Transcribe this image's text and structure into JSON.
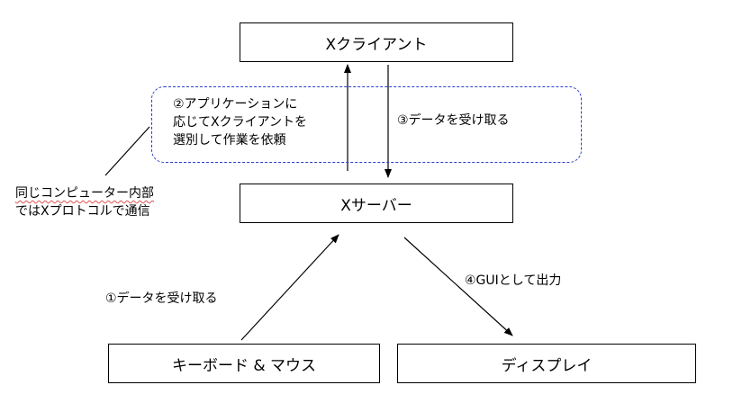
{
  "nodes": {
    "x_client": "Xクライアント",
    "x_server": "Xサーバー",
    "keyboard_mouse": "キーボード & マウス",
    "display": "ディスプレイ"
  },
  "edges": {
    "app_request": [
      "②アプリケーションに",
      "応じてXクライアントを",
      "選別して作業を依頼"
    ],
    "client_receive": "③データを受け取る",
    "server_receive": "①データを受け取る",
    "gui_output": "④GUIとして出力"
  },
  "note": {
    "lines": [
      "同じコンピューター内部",
      "ではXプロトコルで通信"
    ]
  },
  "colors": {
    "line": "#000000",
    "group_border": "#2d3ec8",
    "spellcheck": "#e05050"
  }
}
